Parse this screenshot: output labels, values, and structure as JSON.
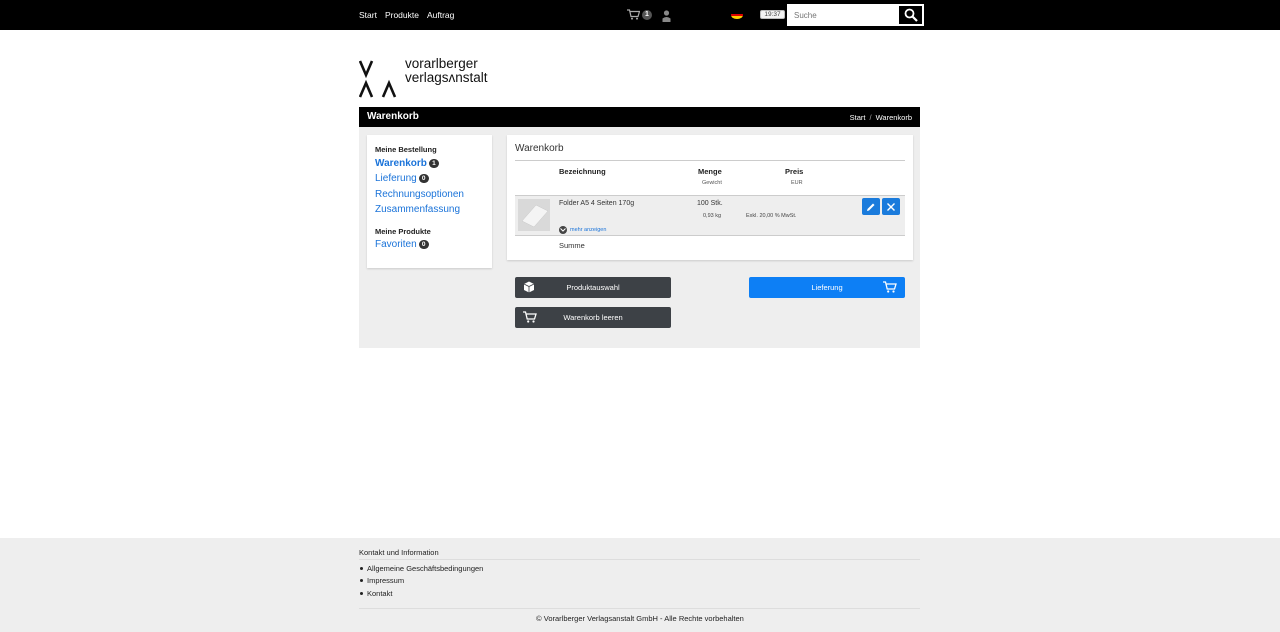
{
  "topnav": {
    "items": [
      "Start",
      "Produkte",
      "Auftrag"
    ]
  },
  "topbar": {
    "cart_count": "1",
    "clock": "19:37"
  },
  "search": {
    "placeholder": "Suche"
  },
  "logo": {
    "line1": "vorarlberger",
    "line2": "verlagsʌnstalt"
  },
  "titlebar": {
    "title": "Warenkorb",
    "crumb_start": "Start",
    "crumb_sep": "/",
    "crumb_current": "Warenkorb"
  },
  "sidebar": {
    "order_heading": "Meine Bestellung",
    "items": [
      {
        "label": "Warenkorb",
        "badge": "1"
      },
      {
        "label": "Lieferung",
        "badge": "0"
      },
      {
        "label": "Rechnungsoptionen"
      },
      {
        "label": "Zusammenfassung"
      }
    ],
    "products_heading": "Meine Produkte",
    "favorites": {
      "label": "Favoriten",
      "badge": "0"
    }
  },
  "cart": {
    "title": "Warenkorb",
    "columns": {
      "name": "Bezeichnung",
      "qty": "Menge",
      "qty_sub": "Gewicht",
      "price": "Preis",
      "price_sub": "EUR"
    },
    "item": {
      "name": "Folder A5 4 Seiten 170g",
      "qty": "100 Stk.",
      "weight": "0,93 kg",
      "tax": "Exkl. 20,00 % MwSt.",
      "more": "mehr anzeigen"
    },
    "sum_label": "Summe"
  },
  "buttons": {
    "product_selection": "Produktauswahl",
    "delivery": "Lieferung",
    "empty_cart": "Warenkorb leeren"
  },
  "footer": {
    "heading": "Kontakt und Information",
    "links": [
      "Allgemeine Geschäftsbedingungen",
      "Impressum",
      "Kontakt"
    ],
    "copyright": "© Vorarlberger Verlagsanstalt GmbH - Alle Rechte vorbehalten"
  },
  "colors": {
    "accent": "#1a73d9",
    "button_blue": "#0d7ff5",
    "button_dark": "#3d4146"
  }
}
